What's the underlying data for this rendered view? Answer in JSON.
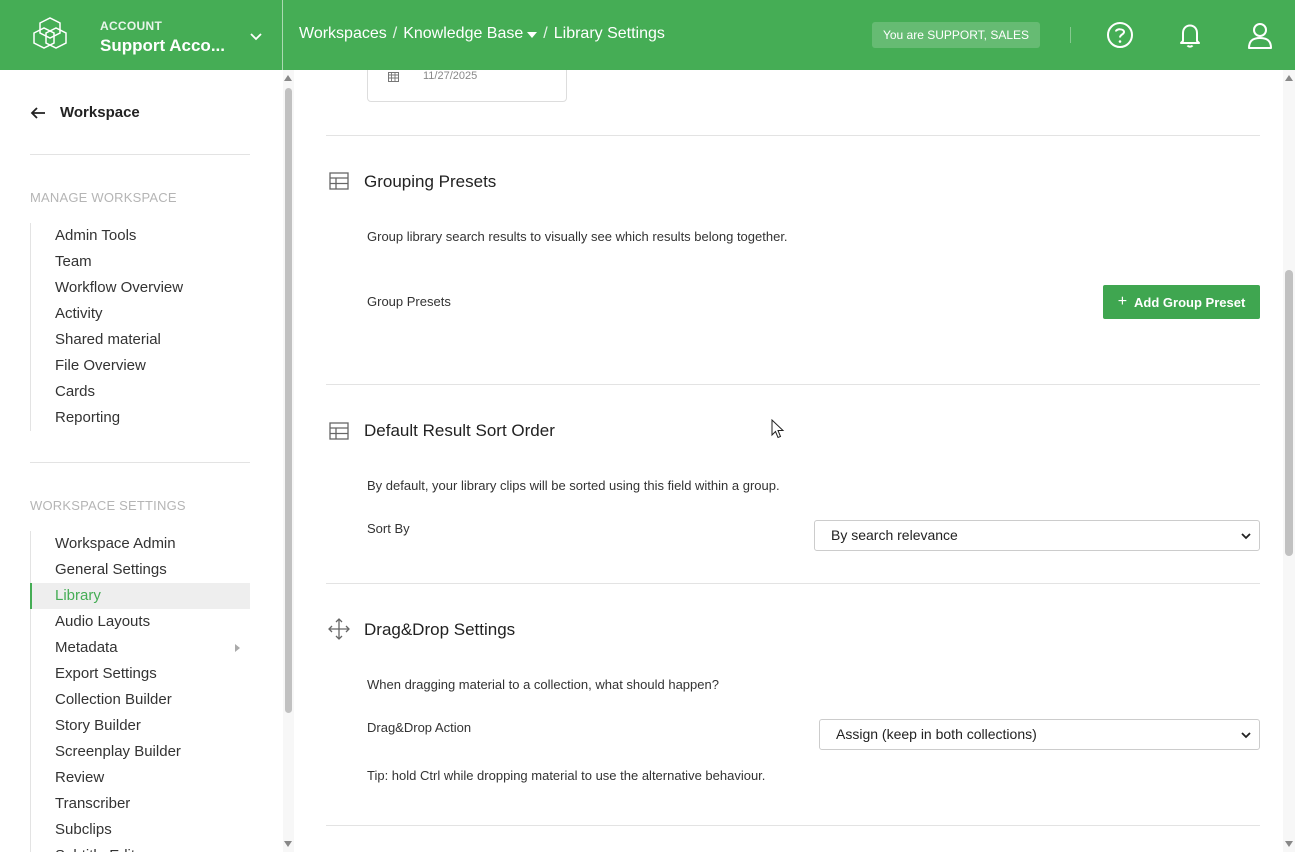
{
  "header": {
    "account_label": "ACCOUNT",
    "account_name": "Support Acco...",
    "breadcrumbs": [
      "Workspaces",
      "Knowledge Base",
      "Library Settings"
    ],
    "role_badge": "You are SUPPORT, SALES",
    "icons": [
      "help-icon",
      "bell-icon",
      "user-icon"
    ],
    "bg_color": "#45ad55"
  },
  "sidebar": {
    "back_label": "Workspace",
    "manage_section": "MANAGE WORKSPACE",
    "manage_items": [
      "Admin Tools",
      "Team",
      "Workflow Overview",
      "Activity",
      "Shared material",
      "File Overview",
      "Cards",
      "Reporting"
    ],
    "settings_section": "WORKSPACE SETTINGS",
    "settings_items": [
      "Workspace Admin",
      "General Settings",
      "Library",
      "Audio Layouts",
      "Metadata",
      "Export Settings",
      "Collection Builder",
      "Story Builder",
      "Screenplay Builder",
      "Review",
      "Transcriber",
      "Subclips",
      "Subtitle Editor"
    ],
    "active_item": "Library"
  },
  "main": {
    "date_value": "11/27/2025",
    "grouping": {
      "title": "Grouping Presets",
      "description": "Group library search results to visually see which results belong together.",
      "field_label": "Group Presets",
      "add_button": "Add Group Preset"
    },
    "sort": {
      "title": "Default Result Sort Order",
      "description": "By default, your library clips will be sorted using this field within a group.",
      "field_label": "Sort By",
      "selected": "By search relevance"
    },
    "dragdrop": {
      "title": "Drag&Drop Settings",
      "description": "When dragging material to a collection, what should happen?",
      "field_label": "Drag&Drop Action",
      "selected": "Assign (keep in both collections)",
      "tip": "Tip: hold Ctrl while dropping material to use the alternative behaviour."
    }
  }
}
